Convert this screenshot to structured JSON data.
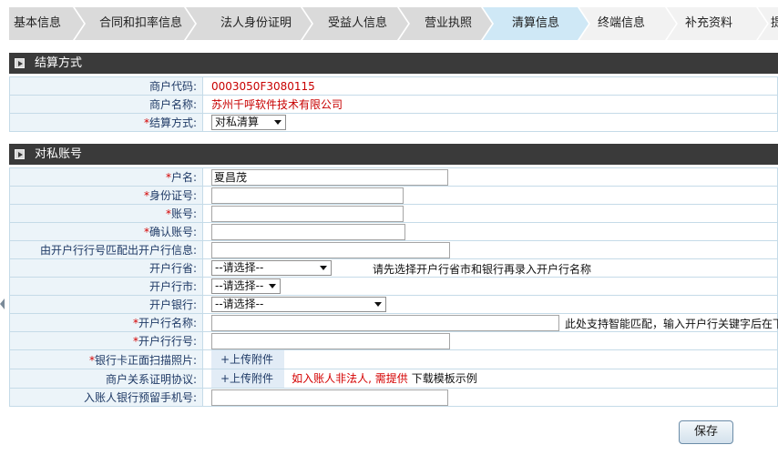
{
  "steps": {
    "items": [
      {
        "label": "基本信息",
        "state": "done"
      },
      {
        "label": "合同和扣率信息",
        "state": "done"
      },
      {
        "label": "法人身份证明",
        "state": "done"
      },
      {
        "label": "受益人信息",
        "state": "done"
      },
      {
        "label": "营业执照",
        "state": "done"
      },
      {
        "label": "清算信息",
        "state": "active"
      },
      {
        "label": "终端信息",
        "state": "todo"
      },
      {
        "label": "补充资料",
        "state": "todo"
      },
      {
        "label": "提",
        "state": "todo"
      }
    ]
  },
  "settlement": {
    "title": "结算方式",
    "merchant_code_label": "商户代码:",
    "merchant_code": "0003050F3080115",
    "merchant_name_label": "商户名称:",
    "merchant_name": "苏州千呼软件技术有限公司",
    "method_label": "结算方式:",
    "method_value": "对私清算"
  },
  "account": {
    "title": "对私账号",
    "account_name_label": "户名:",
    "account_name_value": "夏昌茂",
    "id_label": "身份证号:",
    "id_value": "",
    "account_no_label": "账号:",
    "account_no_value": "",
    "confirm_label": "确认账号:",
    "confirm_value": "",
    "match_label": "由开户行行号匹配出开户行信息:",
    "match_value": "",
    "province_label": "开户行省:",
    "province_value": "--请选择--",
    "province_hint": "请先选择开户行省市和银行再录入开户行名称",
    "city_label": "开户行市:",
    "city_value": "--请选择--",
    "bank_label": "开户银行:",
    "bank_value": "--请选择--",
    "branch_name_label": "开户行名称:",
    "branch_name_value": "",
    "branch_hint": "此处支持智能匹配，输入开户行关键字后在下",
    "branch_no_label": "开户行行号:",
    "branch_no_value": "",
    "card_scan_label": "银行卡正面扫描照片:",
    "upload_label": "+上传附件",
    "relation_label": "商户关系证明协议:",
    "relation_upload_label": "+上传附件",
    "relation_note": "如入账人非法人, 需提供",
    "relation_template": "下载模板示例",
    "phone_label": "入账人银行预留手机号:",
    "phone_value": ""
  },
  "save_label": "保存",
  "colors": {
    "section_header": "#3a3a3a",
    "label_bg": "#ecf4f9",
    "border": "#c5dbe8",
    "tab_done": "#dadada",
    "tab_active": "#cfe8f6",
    "required": "#d40000"
  }
}
